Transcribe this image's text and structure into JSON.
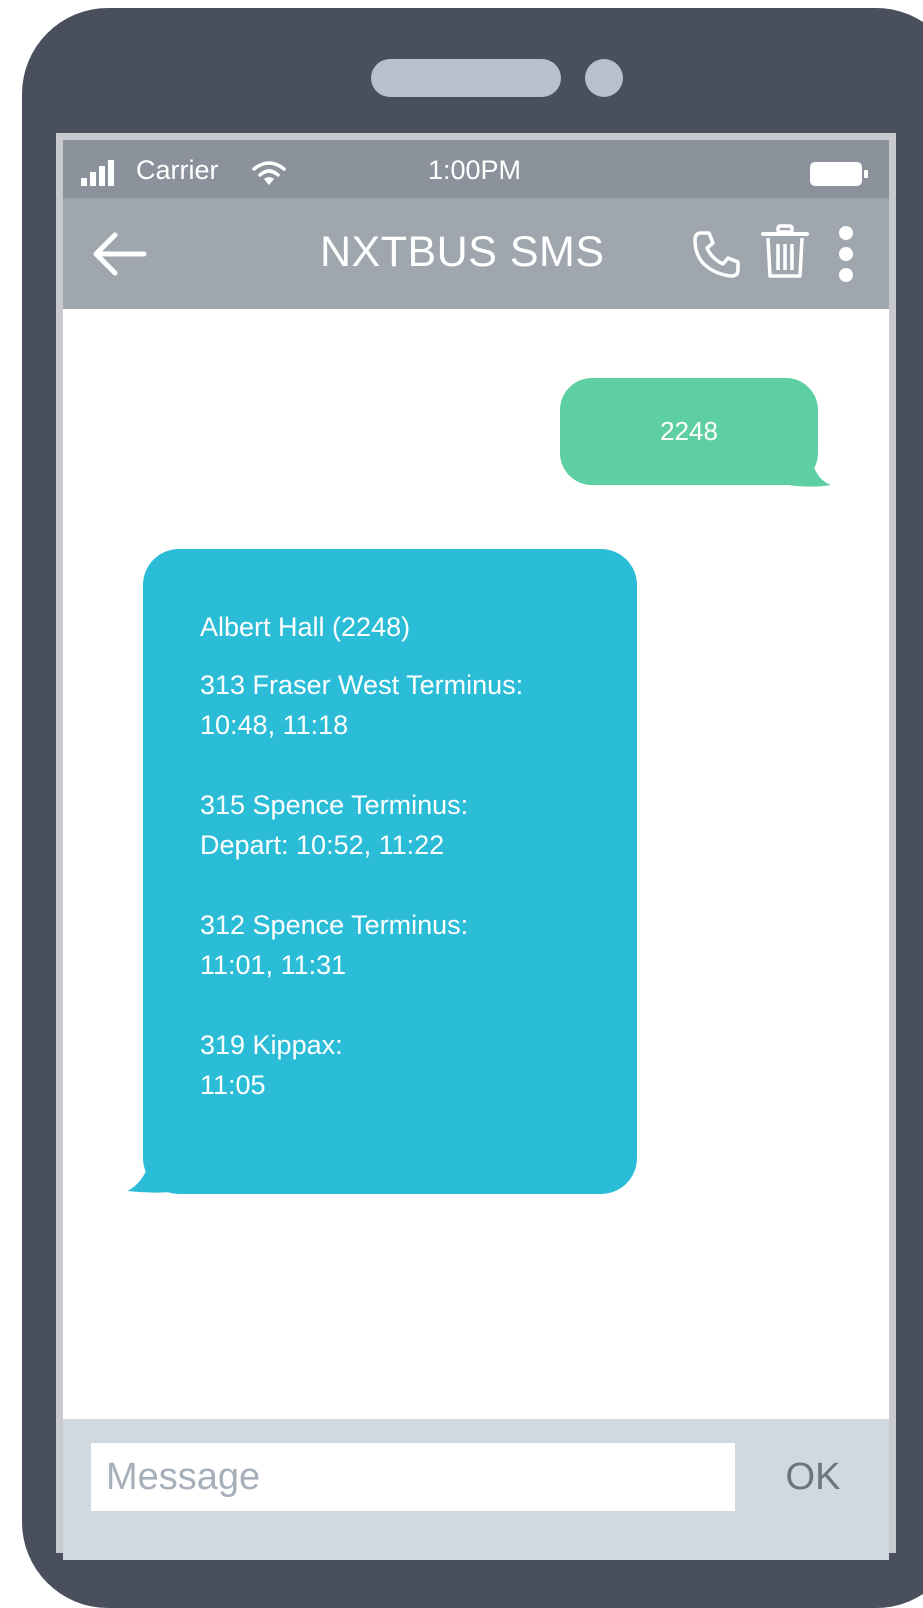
{
  "status_bar": {
    "carrier": "Carrier",
    "time": "1:00PM",
    "signal_icon": "signal-bars-icon",
    "wifi_icon": "wifi-icon",
    "battery_icon": "battery-icon"
  },
  "nav": {
    "title": "NXTBUS SMS",
    "back_icon": "back-arrow-icon",
    "call_icon": "phone-icon",
    "delete_icon": "trash-icon",
    "more_icon": "more-vertical-icon"
  },
  "messages": {
    "sent": {
      "text": "2248"
    },
    "received": {
      "title": "Albert Hall (2248)",
      "routes": [
        {
          "line1": "313 Fraser West Terminus:",
          "line2": "10:48, 11:18"
        },
        {
          "line1": "315 Spence Terminus:",
          "line2": "Depart: 10:52, 11:22"
        },
        {
          "line1": "312 Spence Terminus:",
          "line2": "11:01, 11:31"
        },
        {
          "line1": "319 Kippax:",
          "line2": "11:05"
        }
      ]
    }
  },
  "compose": {
    "placeholder": "Message",
    "value": "",
    "ok_label": "OK"
  },
  "colors": {
    "phone_body": "#4a4f5d",
    "status_bar": "#8c929c",
    "nav_bar": "#a0a6ae",
    "sent_bubble": "#5ecfa2",
    "received_bubble": "#2bbdd8",
    "compose_bar": "#d2d9de"
  }
}
